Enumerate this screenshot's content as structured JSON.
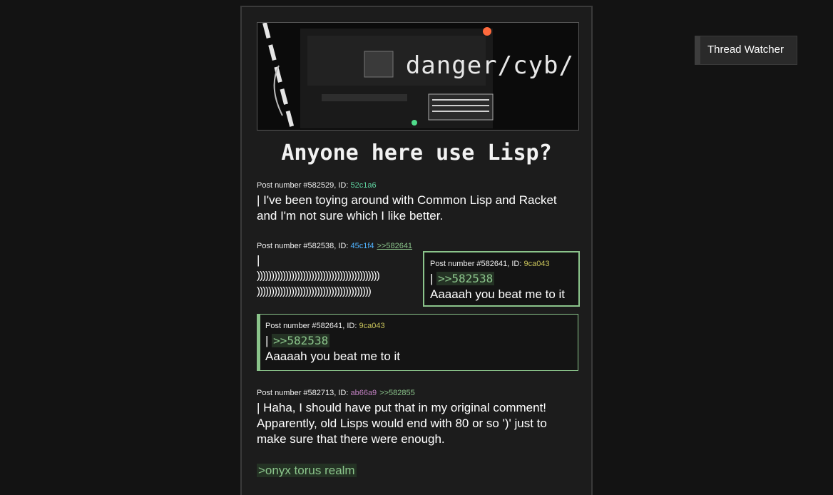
{
  "banner": {
    "text": "danger/cyb/"
  },
  "thread": {
    "title": "Anyone here use Lisp?"
  },
  "posts": [
    {
      "meta_prefix": "Post number #582529, ID: ",
      "id": "52c1a6",
      "id_color": "#5fd3a0",
      "body": "| I've been toying around with Common Lisp and Racket and I'm not sure which I like better."
    },
    {
      "meta_prefix": "Post number #582538, ID: ",
      "id": "45c1f4",
      "id_color": "#4fb3ff",
      "reply_link": ">>582641",
      "body_bar": "|",
      "body_line1": ")))))))))))))))))))))))))))))))))))))))))))",
      "body_line2": "))))))))))))))))))))))))))))))))))))))))"
    },
    {
      "meta_prefix": "Post number #582713, ID: ",
      "id": "ab66a9",
      "id_color": "#c07fc0",
      "reply_link": ">>582855",
      "body": "| Haha, I should have put that in my original comment! Apparently, old Lisps would end with 80 or so ')' just to make sure that there were enough.",
      "greentext": ">onyx torus realm"
    }
  ],
  "quoted_post": {
    "meta_prefix": "Post number #582641, ID: ",
    "id": "9ca043",
    "id_color": "#c8c35a",
    "bar": "| ",
    "quote": ">>582538",
    "body": "Aaaaah you beat me to it"
  },
  "thread_watcher": {
    "label": "Thread Watcher"
  }
}
